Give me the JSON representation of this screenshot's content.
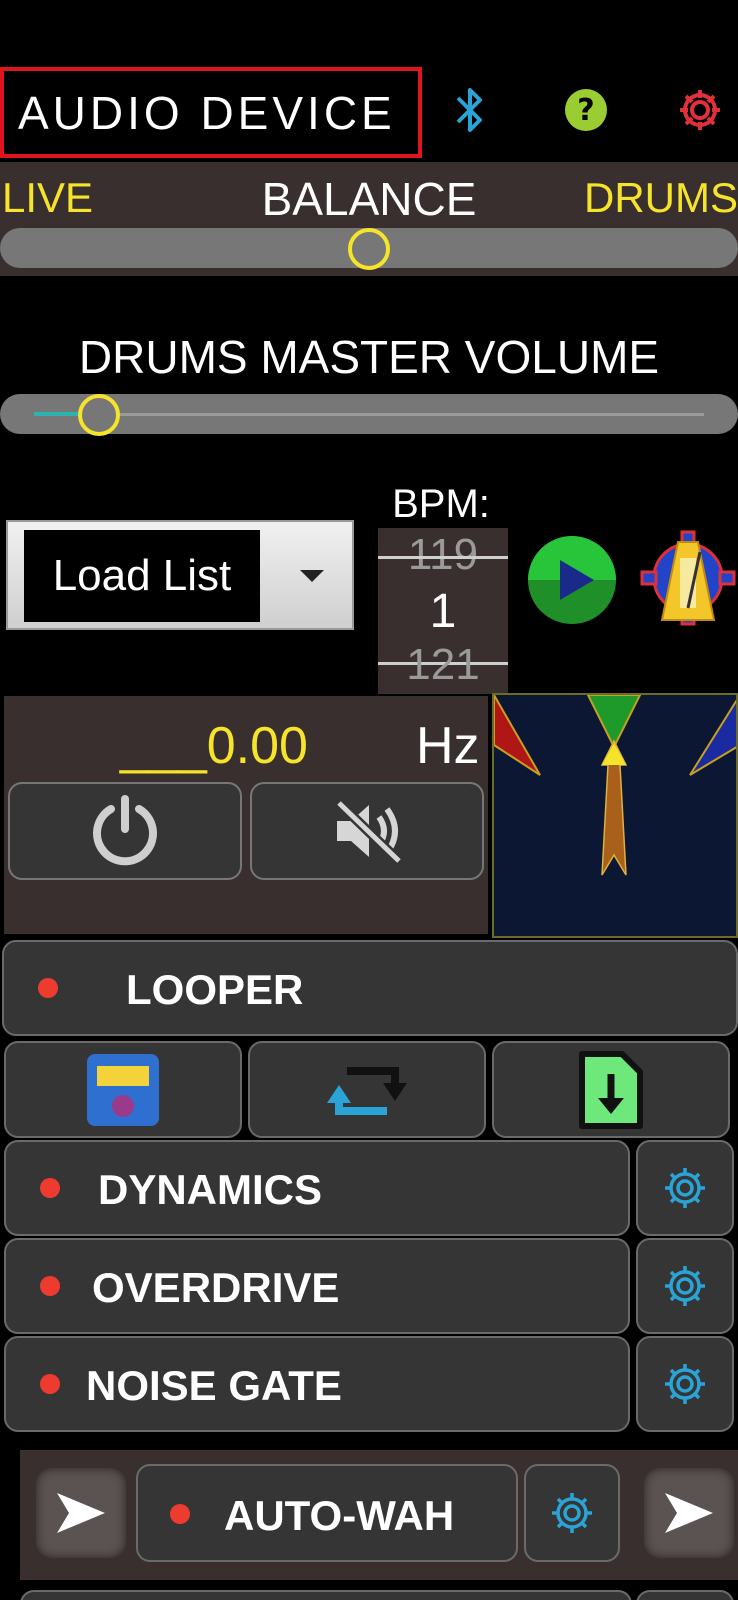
{
  "header": {
    "device_label": "AUDIO DEVICE",
    "icons": [
      "bluetooth-icon",
      "help-icon",
      "settings-gear-icon"
    ]
  },
  "balance": {
    "left_label": "LIVE",
    "title": "BALANCE",
    "right_label": "DRUMS",
    "value_fraction": 0.5
  },
  "drums_master_volume": {
    "title": "DRUMS MASTER VOLUME",
    "value_fraction": 0.1
  },
  "drum_controls": {
    "load_list_label": "Load List",
    "bpm_label": "BPM:",
    "bpm_prev": "119",
    "bpm_current": "1",
    "bpm_next": "121"
  },
  "tuner": {
    "frequency": "___0.00",
    "unit": "Hz"
  },
  "looper": {
    "label": "LOOPER",
    "buttons": [
      "save-icon",
      "loop-icon",
      "import-file-icon"
    ]
  },
  "effects": [
    {
      "label": "DYNAMICS"
    },
    {
      "label": "OVERDRIVE"
    },
    {
      "label": "NOISE GATE"
    },
    {
      "label": "AUTO-WAH"
    }
  ],
  "colors": {
    "accent_yellow": "#f5e42a",
    "device_border_red": "#e0141e",
    "gear_blue": "#2aa3d6",
    "status_red": "#ee3b2f",
    "panel_brown": "#3a2f2f"
  }
}
